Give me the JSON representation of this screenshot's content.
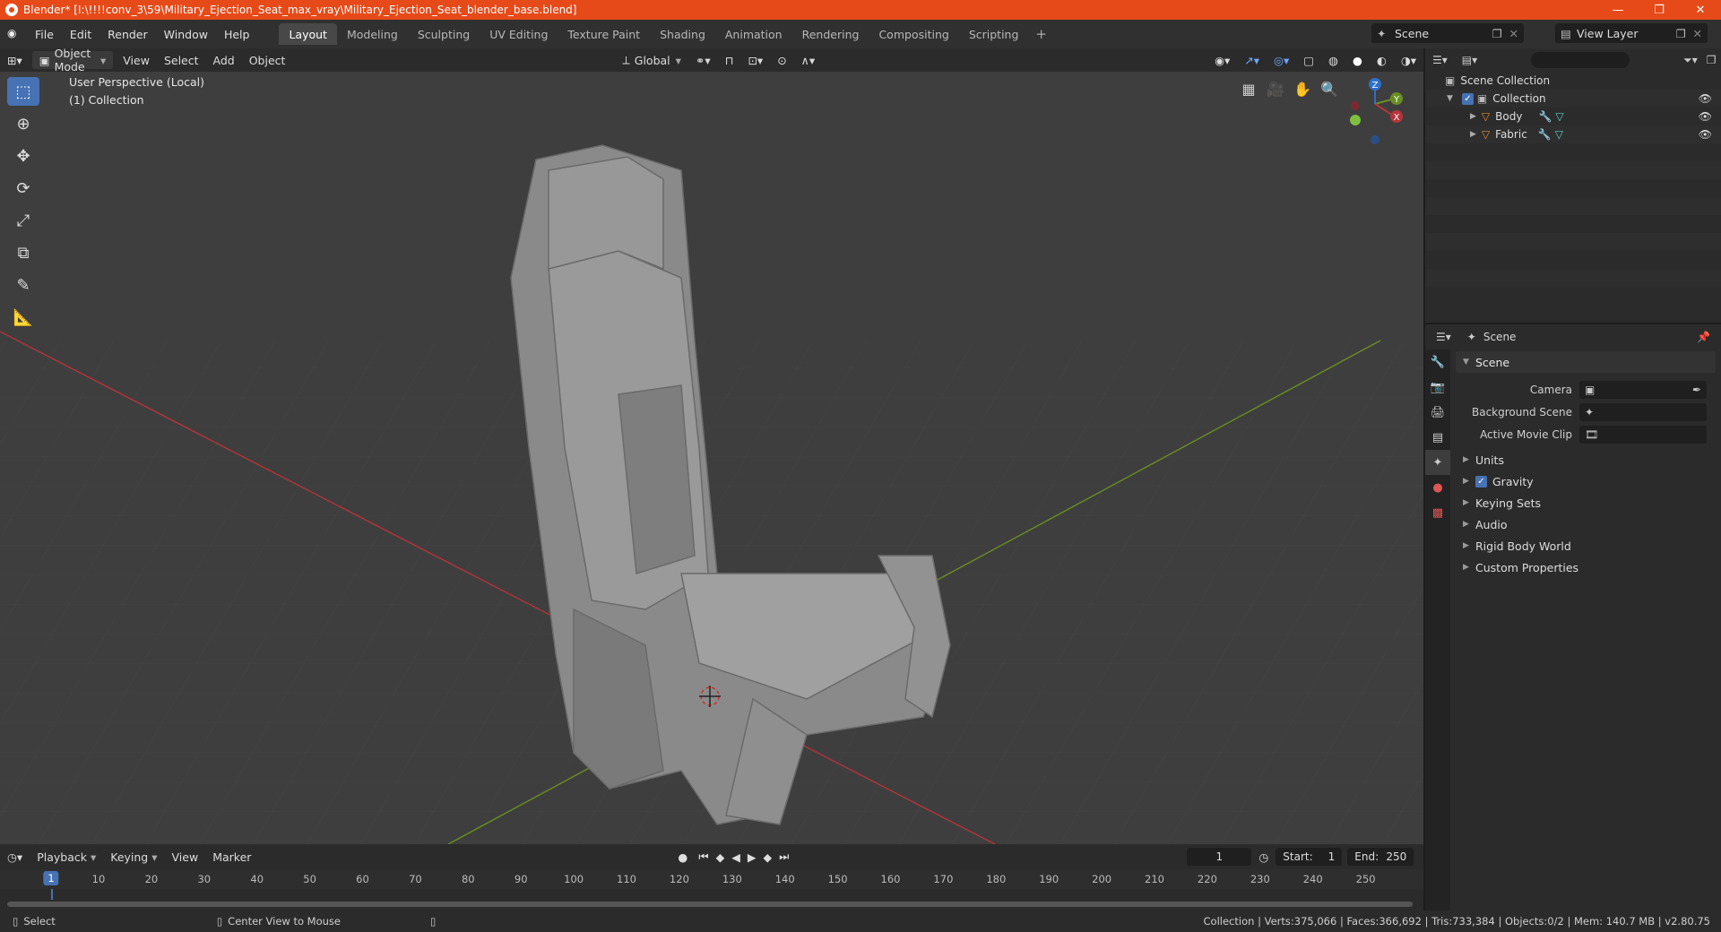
{
  "window": {
    "title": "Blender* [I:\\!!!!conv_3\\59\\Military_Ejection_Seat_max_vray\\Military_Ejection_Seat_blender_base.blend]",
    "minimize": "—",
    "maximize": "❐",
    "close": "✕"
  },
  "menu": [
    "File",
    "Edit",
    "Render",
    "Window",
    "Help"
  ],
  "workspaces": [
    "Layout",
    "Modeling",
    "Sculpting",
    "UV Editing",
    "Texture Paint",
    "Shading",
    "Animation",
    "Rendering",
    "Compositing",
    "Scripting"
  ],
  "active_workspace": "Layout",
  "scene_name": "Scene",
  "view_layer": "View Layer",
  "viewport_header": {
    "mode": "Object Mode",
    "items": [
      "View",
      "Select",
      "Add",
      "Object"
    ],
    "transform": "Global"
  },
  "viewport": {
    "perspective": "User Perspective (Local)",
    "collection": "(1) Collection"
  },
  "gizmo": {
    "z": "Z",
    "y": "Y",
    "x": "X"
  },
  "outliner": {
    "root": "Scene Collection",
    "collection": "Collection",
    "objects": [
      "Body",
      "Fabric"
    ]
  },
  "properties": {
    "header": "Scene",
    "panel": "Scene",
    "fields": [
      {
        "label": "Camera"
      },
      {
        "label": "Background Scene"
      },
      {
        "label": "Active Movie Clip"
      }
    ],
    "subpanels": [
      "Units",
      "Gravity",
      "Keying Sets",
      "Audio",
      "Rigid Body World",
      "Custom Properties"
    ]
  },
  "timeline": {
    "menus": [
      "Playback",
      "Keying",
      "View",
      "Marker"
    ],
    "current_frame": "1",
    "start_label": "Start:",
    "start": "1",
    "end_label": "End:",
    "end": "250",
    "ticks": [
      "10",
      "20",
      "30",
      "40",
      "50",
      "60",
      "70",
      "80",
      "90",
      "100",
      "110",
      "120",
      "130",
      "140",
      "150",
      "160",
      "170",
      "180",
      "190",
      "200",
      "210",
      "220",
      "230",
      "240",
      "250"
    ]
  },
  "status": {
    "left": "Select",
    "middle": "Center View to Mouse",
    "right": "Collection | Verts:375,066 | Faces:366,692 | Tris:733,384 | Objects:0/2 | Mem: 140.7 MB | v2.80.75"
  },
  "colors": {
    "accent": "#4772b3",
    "titlebar": "#e64a19",
    "x_axis": "#b5343a",
    "y_axis": "#6b8e23",
    "z_axis": "#2d6fc9",
    "object_icon": "#e8892b"
  }
}
